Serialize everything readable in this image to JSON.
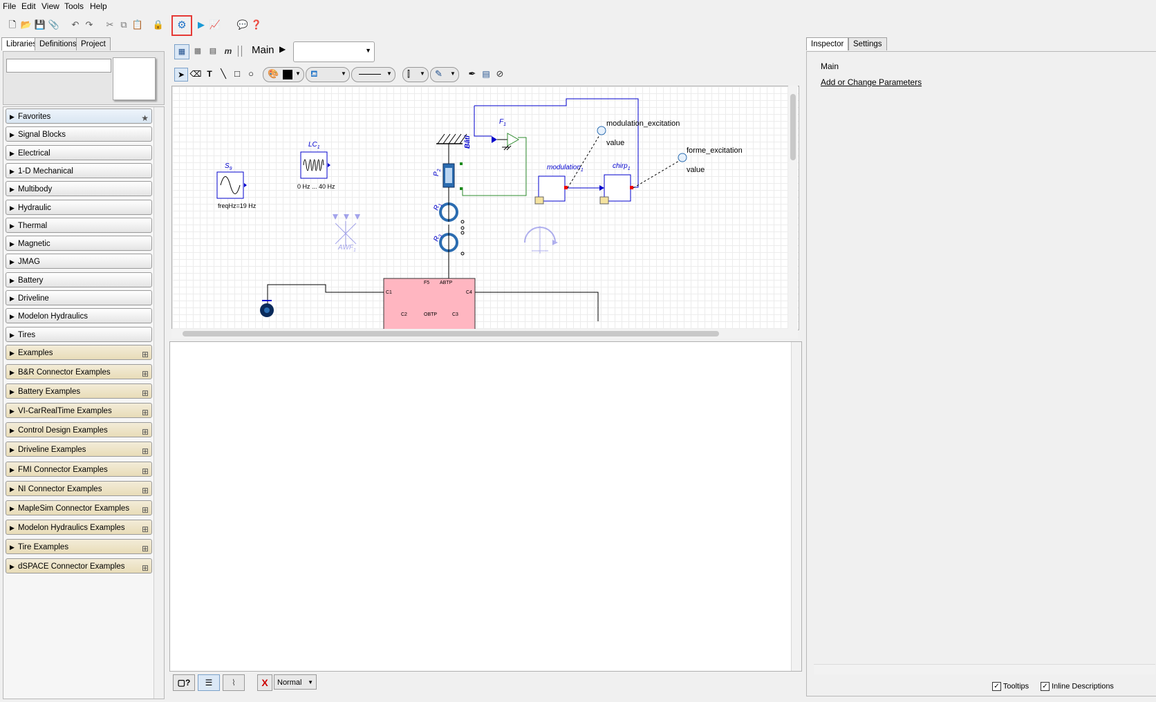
{
  "menu": [
    "File",
    "Edit",
    "View",
    "Tools",
    "Help"
  ],
  "left_tabs": [
    "Libraries",
    "Definitions",
    "Project"
  ],
  "libraries": [
    {
      "label": "Favorites",
      "kind": "fav"
    },
    {
      "label": "Signal Blocks",
      "kind": "lib"
    },
    {
      "label": "Electrical",
      "kind": "lib"
    },
    {
      "label": "1-D Mechanical",
      "kind": "lib"
    },
    {
      "label": "Multibody",
      "kind": "lib"
    },
    {
      "label": "Hydraulic",
      "kind": "lib"
    },
    {
      "label": "Thermal",
      "kind": "lib"
    },
    {
      "label": "Magnetic",
      "kind": "lib"
    },
    {
      "label": "JMAG",
      "kind": "lib"
    },
    {
      "label": "Battery",
      "kind": "lib"
    },
    {
      "label": "Driveline",
      "kind": "lib"
    },
    {
      "label": "Modelon Hydraulics",
      "kind": "lib"
    },
    {
      "label": "Tires",
      "kind": "lib"
    },
    {
      "label": "Examples",
      "kind": "ex"
    },
    {
      "label": "B&R Connector Examples",
      "kind": "ex"
    },
    {
      "label": "Battery Examples",
      "kind": "ex"
    },
    {
      "label": "VI-CarRealTime Examples",
      "kind": "ex"
    },
    {
      "label": "Control Design Examples",
      "kind": "ex"
    },
    {
      "label": "Driveline Examples",
      "kind": "ex"
    },
    {
      "label": "FMI Connector Examples",
      "kind": "ex"
    },
    {
      "label": "NI Connector Examples",
      "kind": "ex"
    },
    {
      "label": "MapleSim Connector Examples",
      "kind": "ex"
    },
    {
      "label": "Modelon Hydraulics Examples",
      "kind": "ex"
    },
    {
      "label": "Tire Examples",
      "kind": "ex"
    },
    {
      "label": "dSPACE Connector Examples",
      "kind": "ex"
    }
  ],
  "breadcrumb": "Main",
  "diagram": {
    "s_label": "S",
    "s_sub": "9",
    "s_param": "freqHz=19 Hz",
    "lc_label": "LC",
    "lc_sub": "1",
    "lc_param": "0 Hz ... 40 Hz",
    "bati": "Bâti",
    "f_label": "F",
    "f_sub": "1",
    "p_label": "P",
    "p_sub": "2",
    "r1_label": "R",
    "r1_sub": "1",
    "r2_label": "R",
    "r2_sub": "3",
    "awf": "AWF",
    "awf_sub": "1",
    "modulation": "modulation",
    "modulation_sub": "1",
    "chirp": "chirp",
    "chirp_sub": "1",
    "mod_exc": "modulation_excitation",
    "forme_exc": "forme_excitation",
    "value1": "value",
    "value2": "value",
    "block_f5": "F5",
    "block_abtp": "ABTP",
    "block_c1": "C1",
    "block_c4": "C4",
    "block_c2": "C2",
    "block_obtp": "OBTP",
    "block_c3": "C3"
  },
  "right_tabs": [
    "Inspector",
    "Settings"
  ],
  "inspector": {
    "title": "Main",
    "link": "Add or Change Parameters"
  },
  "bottom": {
    "mode": "Normal",
    "tooltips": "Tooltips",
    "inline": "Inline Descriptions"
  },
  "colors": {
    "accent": "#e53935",
    "diagram_blue": "#0000cc",
    "wire_green": "#2e8b2e",
    "block_pink": "#ffb6c1"
  }
}
